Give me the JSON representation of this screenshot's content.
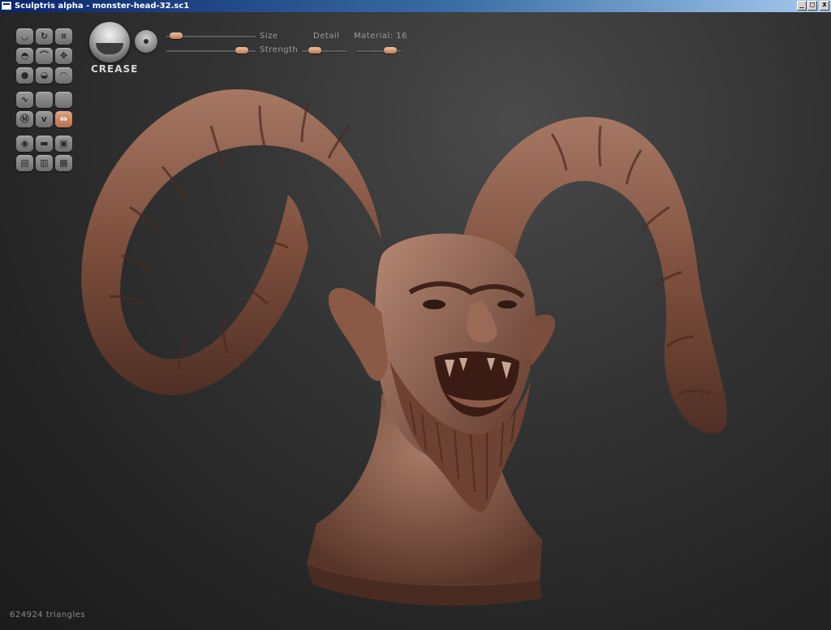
{
  "window": {
    "title": "Sculptris alpha - monster-head-32.sc1",
    "controls": {
      "minimize": "_",
      "maximize": "□",
      "close": "x"
    }
  },
  "brush": {
    "mode_label": "CREASE",
    "size_label": "Size",
    "strength_label": "Strength",
    "detail_label": "Detail",
    "material_label": "Material: 16"
  },
  "sliders": {
    "size": 0.04,
    "strength": 0.9,
    "detail": 0.2,
    "material": 0.85
  },
  "tools": [
    [
      "draw-icon",
      "rotate-icon",
      "crop-icon"
    ],
    [
      "inflate-icon",
      "pinch-icon",
      "grab-icon"
    ],
    [
      "flatten-icon",
      "smooth-icon",
      "reduce-icon"
    ],
    [
      "curve-icon",
      "blank-icon",
      "blank-icon"
    ],
    [
      "symmetry-icon",
      "wave-icon",
      "swap-icon"
    ],
    [
      "sphere-icon",
      "plane-icon",
      "save-icon"
    ],
    [
      "open-icon",
      "import-icon",
      "export-icon"
    ]
  ],
  "status": {
    "triangles": "624924 triangles"
  },
  "colors": {
    "accent": "#c98a66",
    "clay": "#8c5b48",
    "background": "#2e2e2e"
  }
}
